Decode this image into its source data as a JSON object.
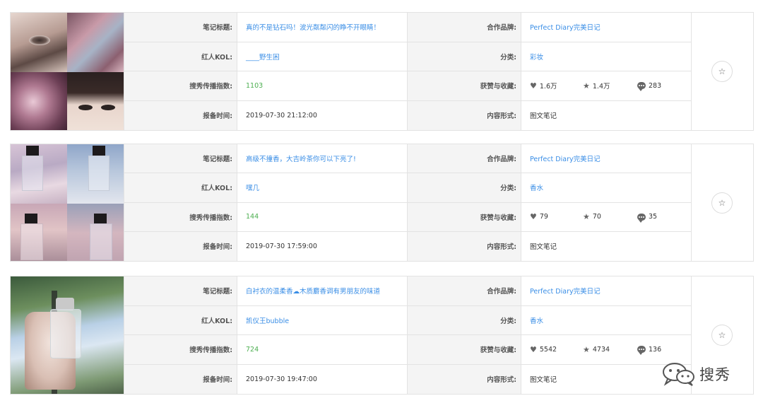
{
  "labels": {
    "title": "笔记标题:",
    "kol": "红人KOL:",
    "index": "搜秀传播指数:",
    "time": "报备时间:",
    "brand": "合作品牌:",
    "category": "分类:",
    "engagement": "获赞与收藏:",
    "form": "内容形式:"
  },
  "icons": {
    "like": "heart-icon",
    "favorite": "star-icon",
    "comment": "comment-icon",
    "bookmark": "star-outline-icon"
  },
  "colors": {
    "link": "#3a8ee6",
    "index": "#4caf50",
    "label_bg": "#f4f4f4",
    "border": "#e3e3e3"
  },
  "posts": [
    {
      "title": "真的不是钻石吗！波光粼粼闪的睁不开眼睛！",
      "kol": "____野生困",
      "index": "1103",
      "time": "2019-07-30 21:12:00",
      "brand": "Perfect Diary完美日记",
      "category": "彩妆",
      "likes": "1.6万",
      "favorites": "1.4万",
      "comments": "283",
      "form": "图文笔记"
    },
    {
      "title": "高级不撞香，大吉岭茶你可以下亮了!",
      "kol": "嘿几",
      "index": "144",
      "time": "2019-07-30 17:59:00",
      "brand": "Perfect Diary完美日记",
      "category": "香水",
      "likes": "79",
      "favorites": "70",
      "comments": "35",
      "form": "图文笔记"
    },
    {
      "title": "白衬衣的温柔香☁木质麝香调有男朋友的味道",
      "kol": "凯仪王bubble",
      "index": "724",
      "time": "2019-07-30 19:47:00",
      "brand": "Perfect Diary完美日记",
      "category": "香水",
      "likes": "5542",
      "favorites": "4734",
      "comments": "136",
      "form": "图文笔记"
    }
  ],
  "watermark": {
    "text": "搜秀",
    "icon": "wechat-icon"
  }
}
